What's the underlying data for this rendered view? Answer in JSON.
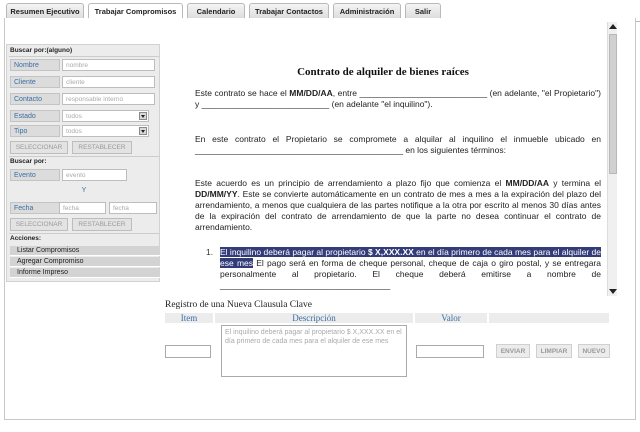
{
  "tabs": [
    {
      "label": "Resumen Ejecutivo",
      "active": false
    },
    {
      "label": "Trabajar Compromisos",
      "active": true
    },
    {
      "label": "Calendario",
      "active": false
    },
    {
      "label": "Trabajar Contactos",
      "active": false
    },
    {
      "label": "Administración",
      "active": false
    },
    {
      "label": "Salir",
      "active": false
    }
  ],
  "sidebar": {
    "search_any_title": "Buscar por:(alguno)",
    "fields": [
      {
        "label": "Nombre",
        "placeholder": "nombre",
        "type": "text"
      },
      {
        "label": "Cliente",
        "placeholder": "cliente",
        "type": "text"
      },
      {
        "label": "Contacto",
        "placeholder": "responsable interno",
        "type": "text"
      },
      {
        "label": "Estado",
        "value": "todos",
        "type": "select"
      },
      {
        "label": "Tipo",
        "value": "todos",
        "type": "select"
      }
    ],
    "select_label": "SELECCIONAR",
    "reset_label": "RESTABLECER",
    "search_title": "Buscar por:",
    "event_label": "Evento",
    "event_placeholder": "evento",
    "and_label": "Y",
    "date_label": "Fecha",
    "date_from_placeholder": "fecha",
    "date_to_placeholder": "fecha",
    "select_label_2": "SELECCIONAR",
    "reset_label_2": "RESTABLECER",
    "actions_title": "Acciones:",
    "actions": [
      "Listar Compromisos",
      "Agregar Compromiso",
      "Informe Impreso"
    ]
  },
  "document": {
    "title": "Contrato de alquiler de bienes raíces",
    "p1_a": "Este contrato se hace el ",
    "p1_date": "MM/DD/AA",
    "p1_b": ", entre ___________________________ (en adelante, \"el Propietario\") y ___________________________ (en adelante \"el inquilino\").",
    "p2": "En este contrato el Propietario se compromete a alquilar al inquilino el inmueble ubicado en ____________________________________________ en los siguientes términos:",
    "p3_a": "Este acuerdo es un principio de arrendamiento a plazo fijo que comienza el ",
    "p3_date1": "MM/DD/AA",
    "p3_b": " y termina el ",
    "p3_date2": "DD/MM/YY",
    "p3_c": ". Este se convierte automáticamente en un contrato de mes a mes a la expiración del plazo del arrendamiento, a menos que cualquiera de las partes notifique a la otra por escrito al menos 30 días antes de la expiración del contrato de arrendamiento de que la parte no desea continuar el contrato de arrendamiento.",
    "item_number": "1.",
    "item_hl_a": "El inquilino deberá pagar al propietario ",
    "item_hl_amount": "$ X,XXX.XX",
    "item_hl_b": " en el día primero de cada mes para el alquiler de ese mes",
    "item_rest": " El pago será en forma de cheque personal, cheque de caja o giro postal, y se entregara personalmente al propietario. El cheque deberá emitirse a nombre de ____________________________________"
  },
  "new_clause": {
    "title": "Registro de una Nueva Clausula Clave",
    "col_item": "Item",
    "col_desc": "Descripción",
    "col_value": "Valor",
    "description_text": "El inquilino deberá pagar al propietario $ X,XXX.XX en el día primero de cada mes para el alquiler de ese mes",
    "send_label": "ENVIAR",
    "clear_label": "LIMPIAR",
    "new_label": "NUEVO"
  },
  "colors": {
    "highlight": "#323c78",
    "label_blue": "#3a6ea5",
    "panel_gray": "#ececec"
  }
}
